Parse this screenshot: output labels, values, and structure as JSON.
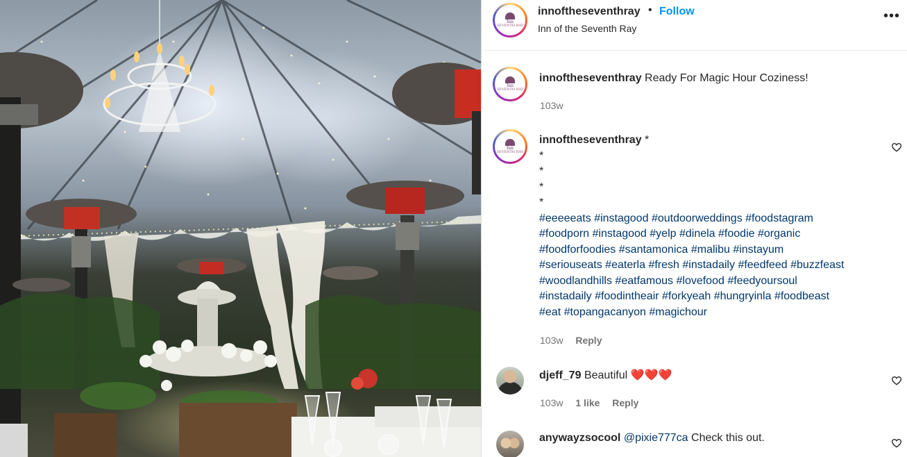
{
  "post": {
    "author": {
      "username": "innoftheseventhray",
      "logo_text_line1": "Inn",
      "logo_text_line2": "SEVENTH RAY",
      "location": "Inn of the Seventh Ray",
      "follow_label": "Follow",
      "separator": "•"
    },
    "more_options_icon": "ellipsis-icon"
  },
  "comments": [
    {
      "username": "innoftheseventhray",
      "text": "Ready For Magic Hour Coziness!",
      "age": "103w"
    },
    {
      "username": "innoftheseventhray",
      "text_lines": [
        "*",
        "*",
        "*",
        "*",
        "*"
      ],
      "hashtag_lines": [
        [
          "#eeeeeats",
          "#instagood",
          "#outdoorweddings",
          "#foodstagram"
        ],
        [
          "#foodporn",
          "#instagood",
          "#yelp",
          "#dinela",
          "#foodie",
          "#organic"
        ],
        [
          "#foodforfoodies",
          "#santamonica",
          "#malibu",
          "#instayum"
        ],
        [
          "#seriouseats",
          "#eaterla",
          "#fresh",
          "#instadaily",
          "#feedfeed",
          "#buzzfeast"
        ],
        [
          "#woodlandhills",
          "#eatfamous",
          "#lovefood",
          "#feedyoursoul"
        ],
        [
          "#instadaily",
          "#foodintheair",
          "#forkyeah",
          "#hungryinla",
          "#foodbeast"
        ],
        [
          "#eat",
          "#topangacanyon",
          "#magichour"
        ]
      ],
      "age": "103w",
      "reply_label": "Reply"
    },
    {
      "username": "djeff_79",
      "text": "Beautiful",
      "emoji": "❤️❤️❤️",
      "age": "103w",
      "likes": "1 like",
      "reply_label": "Reply"
    },
    {
      "username": "anywayzsocool",
      "mention": "@pixie777ca",
      "text": "Check this out."
    }
  ],
  "colors": {
    "link_blue": "#0095f6",
    "hashtag_blue": "#00376b",
    "muted": "#737373",
    "text": "#262626"
  }
}
